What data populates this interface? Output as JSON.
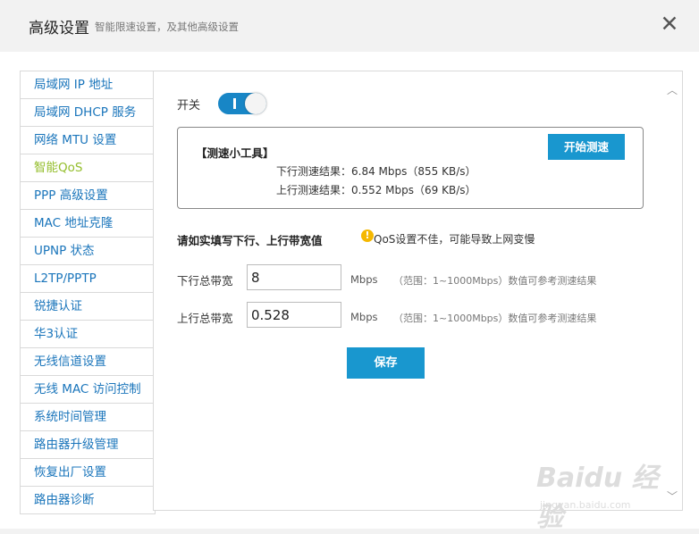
{
  "header": {
    "title": "高级设置",
    "subtitle": "智能限速设置，及其他高级设置",
    "close_glyph": "✕"
  },
  "sidebar": {
    "items": [
      {
        "label": "局域网 IP 地址",
        "active": false
      },
      {
        "label": "局域网 DHCP 服务",
        "active": false
      },
      {
        "label": "网络 MTU 设置",
        "active": false
      },
      {
        "label": "智能QoS",
        "active": true
      },
      {
        "label": "PPP 高级设置",
        "active": false
      },
      {
        "label": "MAC 地址克隆",
        "active": false
      },
      {
        "label": "UPNP 状态",
        "active": false
      },
      {
        "label": "L2TP/PPTP",
        "active": false
      },
      {
        "label": "锐捷认证",
        "active": false
      },
      {
        "label": "华3认证",
        "active": false
      },
      {
        "label": "无线信道设置",
        "active": false
      },
      {
        "label": "无线 MAC 访问控制",
        "active": false
      },
      {
        "label": "系统时间管理",
        "active": false
      },
      {
        "label": "路由器升级管理",
        "active": false
      },
      {
        "label": "恢复出厂设置",
        "active": false
      },
      {
        "label": "路由器诊断",
        "active": false
      }
    ]
  },
  "qos": {
    "switch_label": "开关",
    "switch_on": true,
    "speedtest": {
      "title": "【测速小工具】",
      "download_result": "下行测速结果：6.84 Mbps（855 KB/s）",
      "upload_result": "上行测速结果：0.552 Mbps（69 KB/s）",
      "start_button": "开始测速"
    },
    "bandwidth_heading": "请如实填写下行、上行带宽值",
    "warning_glyph": "!",
    "warning_text": "QoS设置不佳，可能导致上网变慢",
    "download": {
      "label": "下行总带宽",
      "value": "8",
      "unit": "Mbps",
      "hint": "（范围：1~1000Mbps）数值可参考测速结果"
    },
    "upload": {
      "label": "上行总带宽",
      "value": "0.528",
      "unit": "Mbps",
      "hint": "（范围：1~1000Mbps）数值可参考测速结果"
    },
    "save_button": "保存"
  },
  "scroll": {
    "up_glyph": "︿",
    "down_glyph": "﹀"
  },
  "watermark": {
    "main": "Baidu 经验",
    "sub": "jingyan.baidu.com"
  },
  "colors": {
    "accent": "#1997cf",
    "active_item": "#94be2c",
    "link": "#1a75bb",
    "warning": "#f5b800"
  }
}
